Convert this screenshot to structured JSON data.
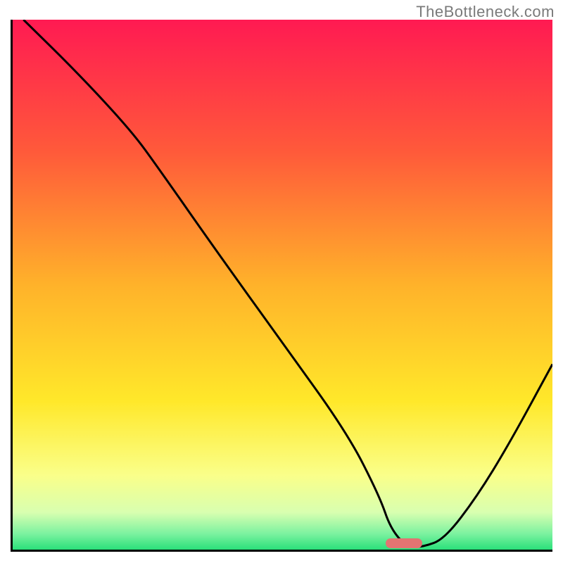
{
  "watermark": "TheBottleneck.com",
  "chart_data": {
    "type": "line",
    "title": "",
    "xlabel": "",
    "ylabel": "",
    "xlim": [
      0,
      100
    ],
    "ylim": [
      0,
      100
    ],
    "grid": false,
    "legend": false,
    "gradient_stops": [
      {
        "offset": 0.0,
        "color": "#ff1a52"
      },
      {
        "offset": 0.25,
        "color": "#ff5a3a"
      },
      {
        "offset": 0.5,
        "color": "#ffb22a"
      },
      {
        "offset": 0.72,
        "color": "#ffe82a"
      },
      {
        "offset": 0.86,
        "color": "#faff8a"
      },
      {
        "offset": 0.93,
        "color": "#d8ffb0"
      },
      {
        "offset": 0.97,
        "color": "#7cf2a0"
      },
      {
        "offset": 1.0,
        "color": "#2ae07a"
      }
    ],
    "series": [
      {
        "name": "bottleneck-curve",
        "color": "#000000",
        "stroke_width": 3,
        "x": [
          2,
          12,
          22,
          27,
          38,
          50,
          62,
          68,
          70,
          73,
          76,
          80,
          86,
          92,
          100
        ],
        "y": [
          100,
          90,
          79,
          72,
          56,
          39,
          22,
          10,
          4,
          0.5,
          0.5,
          2,
          10,
          20,
          35
        ]
      }
    ],
    "marker": {
      "name": "current-pairing",
      "x": 72.5,
      "y": 1.2,
      "color": "#e27472"
    }
  }
}
